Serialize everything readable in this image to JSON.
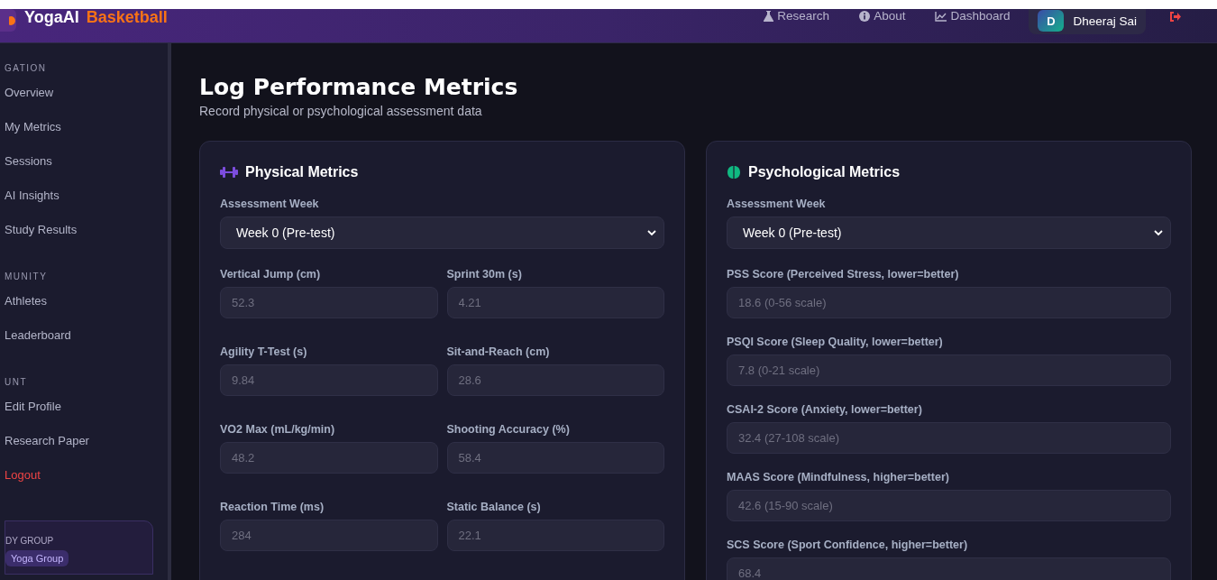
{
  "header": {
    "brand": "YogaAI",
    "brand_accent": "Basketball",
    "nav": [
      {
        "label": "Research"
      },
      {
        "label": "About"
      },
      {
        "label": "Dashboard"
      }
    ],
    "user": {
      "initial": "D",
      "name": "Dheeraj Sai"
    }
  },
  "sidebar": {
    "sections": [
      {
        "title": "GATION",
        "items": [
          {
            "label": "Overview",
            "kind": "link"
          },
          {
            "label": "My Metrics",
            "kind": "link"
          },
          {
            "label": "Sessions",
            "kind": "link"
          },
          {
            "label": "AI Insights",
            "kind": "link"
          },
          {
            "label": "Study Results",
            "kind": "link"
          }
        ]
      },
      {
        "title": "MUNITY",
        "items": [
          {
            "label": "Athletes",
            "kind": "link"
          },
          {
            "label": "Leaderboard",
            "kind": "link"
          }
        ]
      },
      {
        "title": "UNT",
        "items": [
          {
            "label": "Edit Profile",
            "kind": "link"
          },
          {
            "label": "Research Paper",
            "kind": "link"
          },
          {
            "label": "Logout",
            "kind": "danger"
          }
        ]
      }
    ],
    "group_card": {
      "title": "DY GROUP",
      "badge": "Yoga Group"
    }
  },
  "page": {
    "title": "Log Performance Metrics",
    "subtitle": "Record physical or psychological assessment data"
  },
  "cards": [
    {
      "title": "Physical Metrics",
      "kind": "physical",
      "week_label": "Assessment Week",
      "week_value": "Week 0 (Pre-test)",
      "fields": [
        {
          "label": "Vertical Jump (cm)",
          "placeholder": "52.3"
        },
        {
          "label": "Sprint 30m (s)",
          "placeholder": "4.21"
        },
        {
          "label": "Agility T-Test (s)",
          "placeholder": "9.84"
        },
        {
          "label": "Sit-and-Reach (cm)",
          "placeholder": "28.6"
        },
        {
          "label": "VO2 Max (mL/kg/min)",
          "placeholder": "48.2"
        },
        {
          "label": "Shooting Accuracy (%)",
          "placeholder": "58.4"
        },
        {
          "label": "Reaction Time (ms)",
          "placeholder": "284"
        },
        {
          "label": "Static Balance (s)",
          "placeholder": "22.1"
        }
      ]
    },
    {
      "title": "Psychological Metrics",
      "kind": "psychological",
      "week_label": "Assessment Week",
      "week_value": "Week 0 (Pre-test)",
      "fields": [
        {
          "label": "PSS Score (Perceived Stress, lower=better)",
          "placeholder": "18.6 (0-56 scale)"
        },
        {
          "label": "PSQI Score (Sleep Quality, lower=better)",
          "placeholder": "7.8 (0-21 scale)"
        },
        {
          "label": "CSAI-2 Score (Anxiety, lower=better)",
          "placeholder": "32.4 (27-108 scale)"
        },
        {
          "label": "MAAS Score (Mindfulness, higher=better)",
          "placeholder": "42.6 (15-90 scale)"
        },
        {
          "label": "SCS Score (Sport Confidence, higher=better)",
          "placeholder": "68.4"
        }
      ]
    }
  ]
}
